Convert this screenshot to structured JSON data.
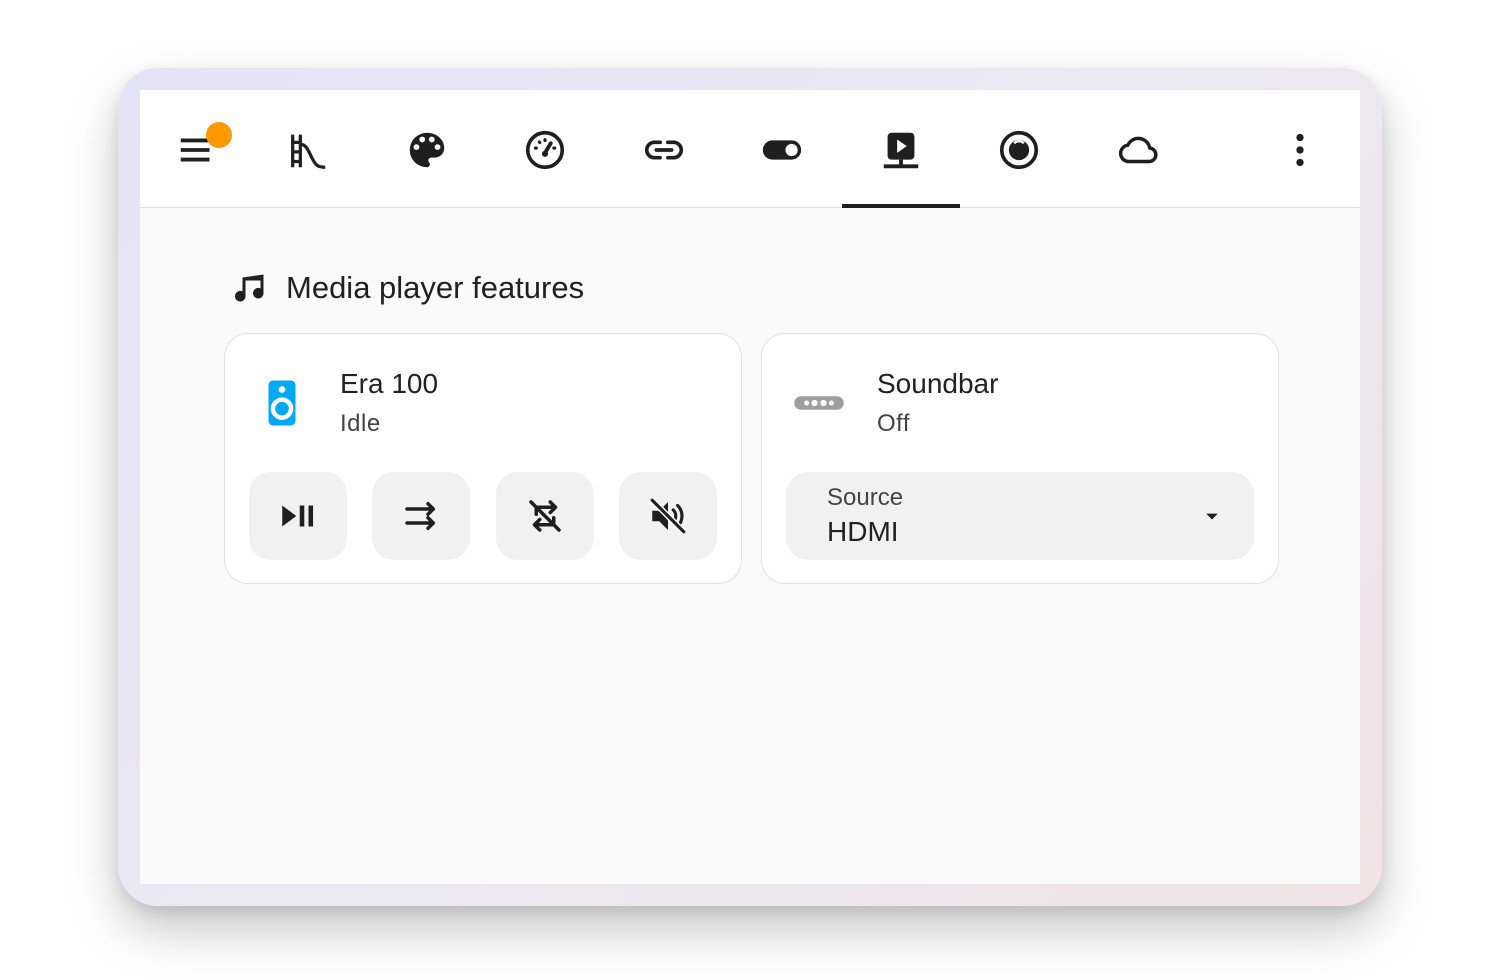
{
  "toolbar": {
    "icons": [
      {
        "name": "menu-icon"
      },
      {
        "name": "slide-icon"
      },
      {
        "name": "palette-icon"
      },
      {
        "name": "gauge-icon"
      },
      {
        "name": "link-icon"
      },
      {
        "name": "toggle-icon"
      },
      {
        "name": "media-player-icon",
        "selected": true
      },
      {
        "name": "robot-vacuum-icon"
      },
      {
        "name": "cloud-icon"
      },
      {
        "name": "more-vertical-icon"
      }
    ],
    "badge_color": "#ff9800"
  },
  "section": {
    "title": "Media player features",
    "icon": "music-note-icon"
  },
  "cards": [
    {
      "name": "Era 100",
      "state": "Idle",
      "icon": "speaker-icon",
      "icon_color": "#03a9f4",
      "controls": [
        {
          "name": "play-pause-icon"
        },
        {
          "name": "shuffle-icon"
        },
        {
          "name": "repeat-off-icon"
        },
        {
          "name": "volume-off-icon"
        }
      ]
    },
    {
      "name": "Soundbar",
      "state": "Off",
      "icon": "soundbar-icon",
      "icon_color": "#9e9e9e",
      "select": {
        "label": "Source",
        "value": "HDMI"
      }
    }
  ]
}
